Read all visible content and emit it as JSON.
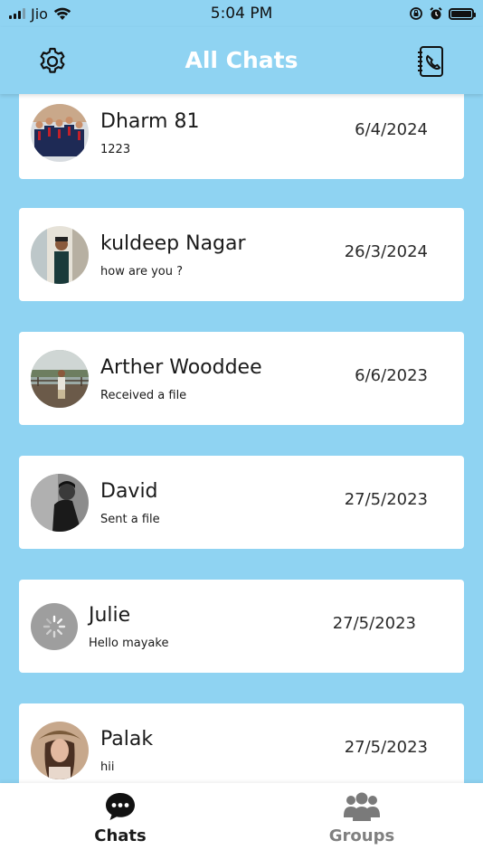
{
  "status_bar": {
    "carrier": "Jio",
    "time": "5:04 PM"
  },
  "header": {
    "title": "All Chats",
    "settings_icon": "gear-icon",
    "contacts_icon": "contacts-book-icon"
  },
  "chats": [
    {
      "name": "Dharm 81",
      "message": "1223",
      "date": "6/4/2024",
      "avatar": "group-photo"
    },
    {
      "name": "kuldeep Nagar",
      "message": "how are you ?",
      "date": "26/3/2024",
      "avatar": "photo"
    },
    {
      "name": "Arther Wooddee",
      "message": "Received a file",
      "date": "6/6/2023",
      "avatar": "photo"
    },
    {
      "name": "David",
      "message": "Sent a file",
      "date": "27/5/2023",
      "avatar": "photo"
    },
    {
      "name": "Julie",
      "message": "Hello mayake",
      "date": "27/5/2023",
      "avatar": "loading-spinner"
    },
    {
      "name": "Palak",
      "message": "hii",
      "date": "27/5/2023",
      "avatar": "photo"
    }
  ],
  "bottom_nav": {
    "tabs": [
      {
        "label": "Chats",
        "icon": "chat-bubble-icon",
        "active": true
      },
      {
        "label": "Groups",
        "icon": "people-group-icon",
        "active": false
      }
    ]
  },
  "colors": {
    "background": "#8fd3f2",
    "card": "#ffffff",
    "title": "#ffffff",
    "active_tab": "#1a1a1a",
    "inactive_tab": "#808080"
  }
}
